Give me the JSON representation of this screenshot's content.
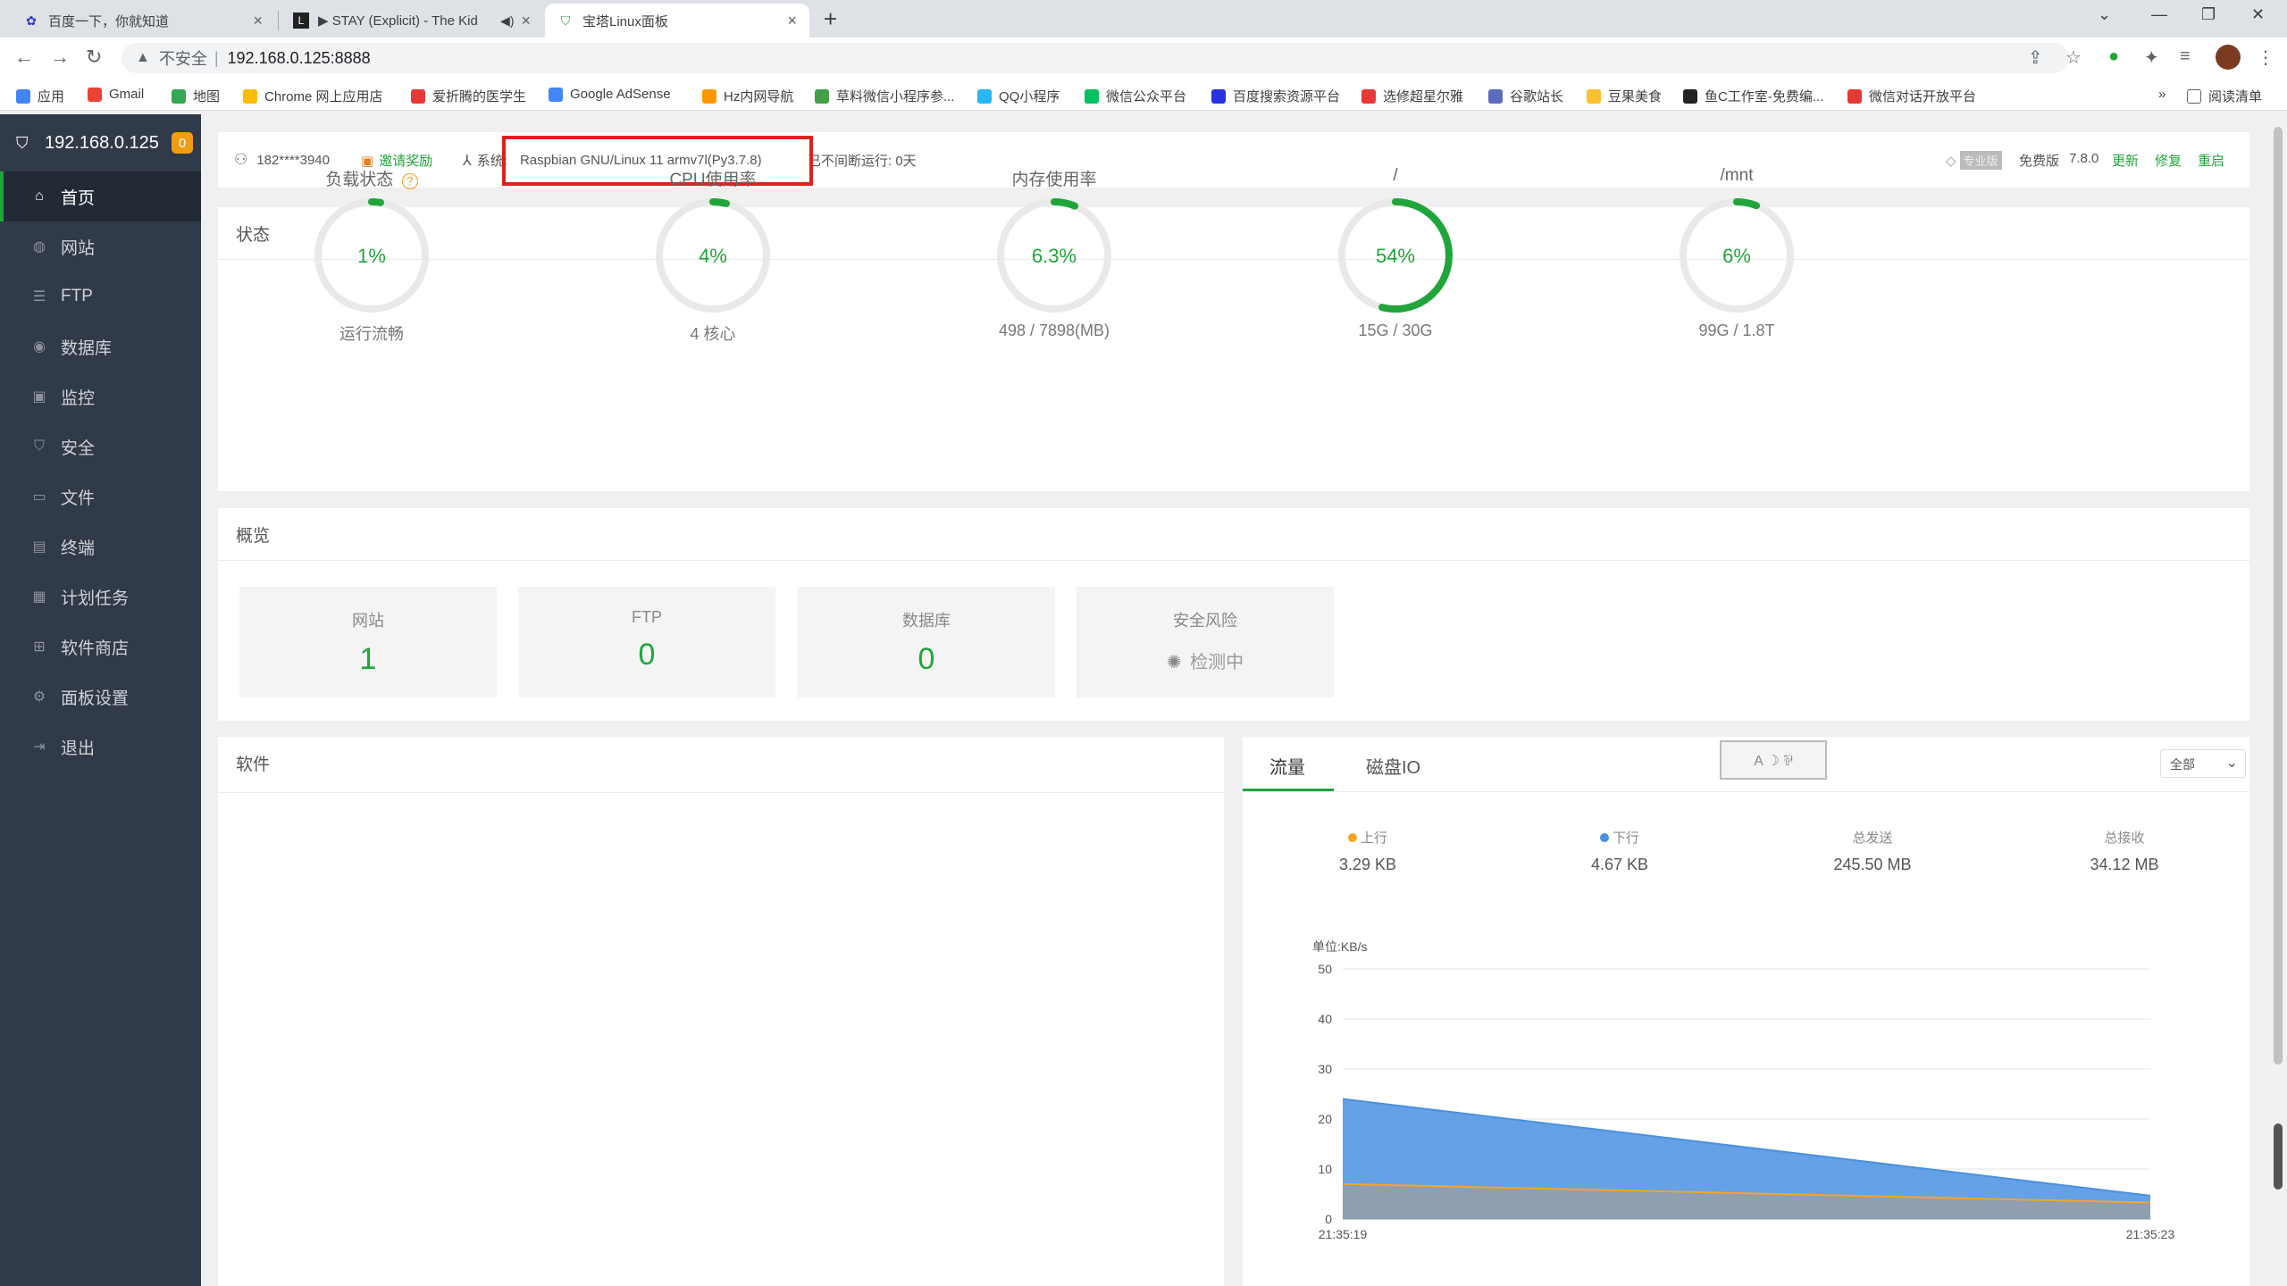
{
  "browser": {
    "tabs": [
      {
        "title": "百度一下，你就知道",
        "icon": "baidu-icon",
        "color": "#2932e1"
      },
      {
        "title": "▶ STAY (Explicit) - The Kid",
        "icon": "lyrics-icon",
        "color": "#222222"
      },
      {
        "title": "宝塔Linux面板",
        "icon": "bt-shield-icon",
        "color": "#20a53a"
      }
    ],
    "address": {
      "insecure_label": "不安全",
      "url": "192.168.0.125:8888"
    },
    "bookmarks": [
      {
        "label": "应用",
        "color": "#4285f4"
      },
      {
        "label": "Gmail",
        "color": "#ea4335"
      },
      {
        "label": "地图",
        "color": "#34a853"
      },
      {
        "label": "Chrome 网上应用店",
        "color": "#fbbc05"
      },
      {
        "label": "爱折腾的医学生",
        "color": "#e53935"
      },
      {
        "label": "Google AdSense",
        "color": "#4285f4"
      },
      {
        "label": "Hz内网导航",
        "color": "#ff9800"
      },
      {
        "label": "草料微信小程序参...",
        "color": "#43a047"
      },
      {
        "label": "QQ小程序",
        "color": "#29b6f6"
      },
      {
        "label": "微信公众平台",
        "color": "#07c160"
      },
      {
        "label": "百度搜索资源平台",
        "color": "#2932e1"
      },
      {
        "label": "选修超星尔雅",
        "color": "#e53935"
      },
      {
        "label": "谷歌站长",
        "color": "#5c6bc0"
      },
      {
        "label": "豆果美食",
        "color": "#fbc02d"
      },
      {
        "label": "鱼C工作室-免费编...",
        "color": "#222222"
      },
      {
        "label": "微信对话开放平台",
        "color": "#e53935"
      }
    ],
    "reading_list": "阅读清单"
  },
  "sidebar": {
    "host": "192.168.0.125",
    "badge": "0",
    "items": [
      {
        "label": "首页",
        "icon": "home-icon",
        "glyph": "⌂"
      },
      {
        "label": "网站",
        "icon": "globe-icon",
        "glyph": "◍"
      },
      {
        "label": "FTP",
        "icon": "ftp-icon",
        "glyph": "☰"
      },
      {
        "label": "数据库",
        "icon": "database-icon",
        "glyph": "◉"
      },
      {
        "label": "监控",
        "icon": "monitor-icon",
        "glyph": "▣"
      },
      {
        "label": "安全",
        "icon": "shield-icon",
        "glyph": "⛉"
      },
      {
        "label": "文件",
        "icon": "folder-icon",
        "glyph": "▭"
      },
      {
        "label": "终端",
        "icon": "terminal-icon",
        "glyph": "▤"
      },
      {
        "label": "计划任务",
        "icon": "calendar-icon",
        "glyph": "▦"
      },
      {
        "label": "软件商店",
        "icon": "apps-icon",
        "glyph": "⊞"
      },
      {
        "label": "面板设置",
        "icon": "gear-icon",
        "glyph": "⚙"
      },
      {
        "label": "退出",
        "icon": "logout-icon",
        "glyph": "⇥"
      }
    ]
  },
  "topinfo": {
    "user": "182****3940",
    "invite": "邀请奖励",
    "system_label": "系统:",
    "system_value": "Raspbian GNU/Linux 11 armv7l(Py3.7.8)",
    "uptime": "已不间断运行: 0天",
    "pro_badge": "专业版",
    "edition": "免费版",
    "version": "7.8.0",
    "update": "更新",
    "repair": "修复",
    "restart": "重启"
  },
  "status": {
    "title": "状态",
    "gauges": [
      {
        "label": "负载状态",
        "value": "1%",
        "fraction": 0.01,
        "sub": "运行流畅",
        "help": "?"
      },
      {
        "label": "CPU使用率",
        "value": "4%",
        "fraction": 0.04,
        "sub": "4 核心"
      },
      {
        "label": "内存使用率",
        "value": "6.3%",
        "fraction": 0.063,
        "sub": "498 / 7898(MB)"
      },
      {
        "label": "/",
        "value": "54%",
        "fraction": 0.54,
        "sub": "15G / 30G"
      },
      {
        "label": "/mnt",
        "value": "6%",
        "fraction": 0.06,
        "sub": "99G / 1.8T"
      }
    ]
  },
  "overview": {
    "title": "概览",
    "cards": [
      {
        "label": "网站",
        "value": "1"
      },
      {
        "label": "FTP",
        "value": "0"
      },
      {
        "label": "数据库",
        "value": "0"
      },
      {
        "label": "安全风险",
        "value": "检测中"
      }
    ]
  },
  "software": {
    "title": "软件"
  },
  "traffic": {
    "tabs": [
      "流量",
      "磁盘IO"
    ],
    "select": "全部",
    "stats": [
      {
        "label": "上行",
        "value": "3.29 KB",
        "dot": "#f5a623"
      },
      {
        "label": "下行",
        "value": "4.67 KB",
        "dot": "#4a90e2"
      },
      {
        "label": "总发送",
        "value": "245.50 MB"
      },
      {
        "label": "总接收",
        "value": "34.12 MB"
      }
    ]
  },
  "chart_data": {
    "type": "area",
    "ylabel": "单位:KB/s",
    "ylim": [
      0,
      50
    ],
    "yticks": [
      "0",
      "10",
      "20",
      "30",
      "40",
      "50"
    ],
    "x": [
      "21:35:19",
      "21:35:23"
    ],
    "series": [
      {
        "name": "下行",
        "values": [
          24,
          4.67
        ],
        "color": "#4a90e2"
      },
      {
        "name": "上行",
        "values": [
          7,
          3.29
        ],
        "color": "#f5a623"
      }
    ],
    "grid": true
  }
}
